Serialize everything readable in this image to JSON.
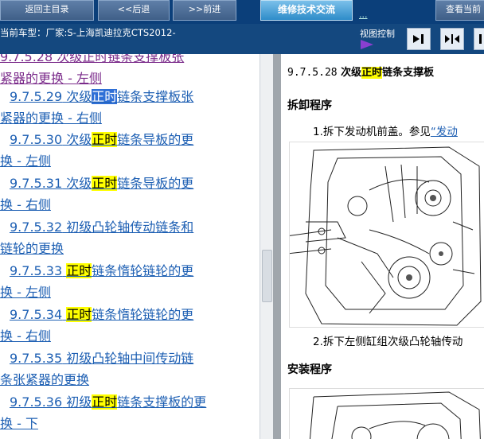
{
  "toolbar": {
    "home": "返回主目录",
    "back": "<<后退",
    "forward": ">>前进",
    "forum": "维修技术交流",
    "link": "...",
    "search": "查看当前"
  },
  "status": {
    "vehicle": "当前车型：厂家:S-上海凯迪拉克CTS2012-",
    "view_control": "视图控制"
  },
  "toc": {
    "items": [
      {
        "l1_pre": "9.7.5.28 次级正时链条支撑板张",
        "l2": "紧器的更换 - 左侧",
        "visited": true
      },
      {
        "num": "9.7.5.29",
        "pre": " 次级",
        "hl": "正时",
        "post": "链条支撑板张",
        "l2": "紧器的更换 - 右侧"
      },
      {
        "num": "9.7.5.30",
        "pre": " 次级",
        "hl": "正时",
        "post": "链条导板的更",
        "l2": "换 - 左侧"
      },
      {
        "num": "9.7.5.31",
        "pre": " 次级",
        "hl": "正时",
        "post": "链条导板的更",
        "l2": "换 - 右侧"
      },
      {
        "num": "9.7.5.32",
        "pre": " 初级凸轮轴传动链条和",
        "l2": "链轮的更换"
      },
      {
        "num": "9.7.5.33",
        "hl": "正时",
        "post": "链条惰轮链轮的更",
        "l2": "换 - 左侧"
      },
      {
        "num": "9.7.5.34",
        "hl": "正时",
        "post": "链条惰轮链轮的更",
        "l2": "换 - 右侧"
      },
      {
        "num": "9.7.5.35",
        "pre": " 初级凸轮轴中间传动链",
        "l2": "条张紧器的更换"
      },
      {
        "num": "9.7.5.36",
        "pre": " 初级",
        "hl": "正时",
        "post": "链条支撑板的更",
        "l2": "换 - 下"
      }
    ]
  },
  "content": {
    "num": "9.7.5.28",
    "title_pre": " 次级",
    "title_hl": "正时",
    "title_post": "链条支撑板",
    "removal": "拆卸程序",
    "step1": "1.拆下发动机前盖。参见",
    "step1_link": "“发动",
    "step2": "2.拆下左侧缸组次级凸轮轴传动",
    "install": "安装程序"
  },
  "colors": {
    "toolbar": "#0b3f7a",
    "highlight": "#ffff00",
    "link": "#1d5fb3",
    "visited": "#7a2a8a"
  }
}
